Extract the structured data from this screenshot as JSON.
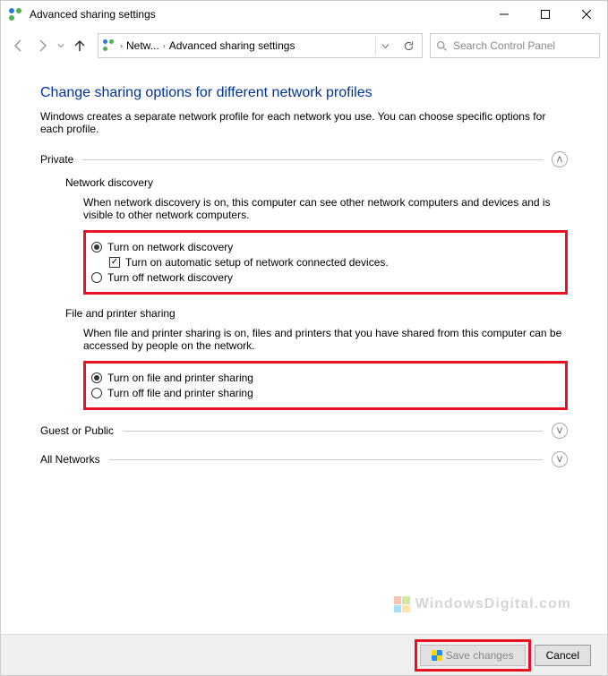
{
  "window": {
    "title": "Advanced sharing settings"
  },
  "address": {
    "crumb1": "Netw...",
    "crumb2": "Advanced sharing settings"
  },
  "search": {
    "placeholder": "Search Control Panel"
  },
  "heading": "Change sharing options for different network profiles",
  "description": "Windows creates a separate network profile for each network you use. You can choose specific options for each profile.",
  "sections": {
    "private": {
      "label": "Private",
      "networkDiscovery": {
        "heading": "Network discovery",
        "desc": "When network discovery is on, this computer can see other network computers and devices and is visible to other network computers.",
        "opt_on": "Turn on network discovery",
        "opt_auto": "Turn on automatic setup of network connected devices.",
        "opt_off": "Turn off network discovery"
      },
      "filePrinter": {
        "heading": "File and printer sharing",
        "desc": "When file and printer sharing is on, files and printers that you have shared from this computer can be accessed by people on the network.",
        "opt_on": "Turn on file and printer sharing",
        "opt_off": "Turn off file and printer sharing"
      }
    },
    "guest": {
      "label": "Guest or Public"
    },
    "all": {
      "label": "All Networks"
    }
  },
  "buttons": {
    "save": "Save changes",
    "cancel": "Cancel"
  },
  "watermark": "WindowsDigital.com"
}
